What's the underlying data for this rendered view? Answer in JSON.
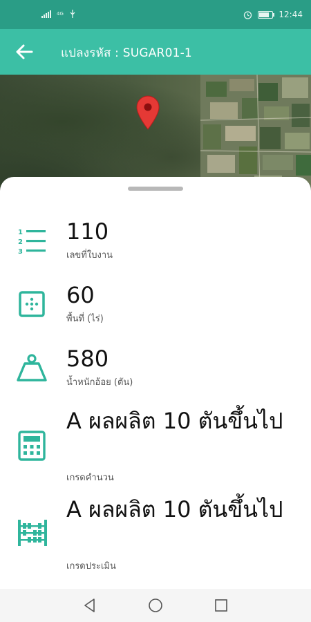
{
  "status_bar": {
    "network": "4G",
    "time": "12:44"
  },
  "app_bar": {
    "title": "แปลงรหัส : SUGAR01-1"
  },
  "map": {
    "pin_color": "#e53935"
  },
  "items": [
    {
      "value": "110",
      "label": "เลขที่ใบงาน",
      "icon": "numbered-list-icon"
    },
    {
      "value": "60",
      "label": "พื้นที่ (ไร่)",
      "icon": "area-grid-icon"
    },
    {
      "value": "580",
      "label": "น้ำหนักอ้อย (ตัน)",
      "icon": "weight-icon"
    },
    {
      "value": "A ผลผลิต 10 ตันขึ้นไป",
      "label": "เกรดคำนวน",
      "icon": "calculator-icon"
    },
    {
      "value": "A ผลผลิต 10 ตันขึ้นไป",
      "label": "เกรดประเมิน",
      "icon": "abacus-icon"
    }
  ],
  "colors": {
    "status_bar": "#2a9d86",
    "app_bar": "#3cbfa5",
    "icon_accent": "#2fb59c"
  }
}
